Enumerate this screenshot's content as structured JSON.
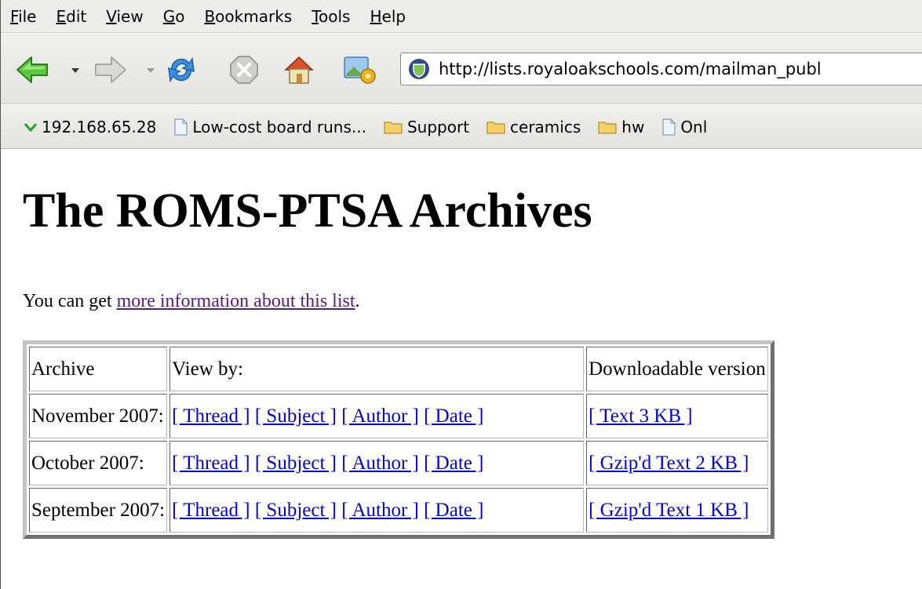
{
  "menu": [
    "File",
    "Edit",
    "View",
    "Go",
    "Bookmarks",
    "Tools",
    "Help"
  ],
  "menu_underline": [
    "F",
    "E",
    "V",
    "G",
    "B",
    "T",
    "H"
  ],
  "toolbar": {
    "back_icon": "back-arrow-icon",
    "forward_icon": "forward-arrow-icon",
    "reload_icon": "reload-icon",
    "stop_icon": "stop-icon",
    "home_icon": "home-icon",
    "url": "http://lists.royaloakschools.com/mailman_publ"
  },
  "bookmarks": [
    {
      "label": "192.168.65.28",
      "icon": "chevron-down-icon"
    },
    {
      "label": "Low-cost board runs...",
      "icon": "page-icon"
    },
    {
      "label": "Support",
      "icon": "folder-icon"
    },
    {
      "label": "ceramics",
      "icon": "folder-icon"
    },
    {
      "label": "hw",
      "icon": "folder-icon"
    },
    {
      "label": "Onl",
      "icon": "page-icon"
    }
  ],
  "page": {
    "title": "The ROMS-PTSA Archives",
    "intro_prefix": "You can get ",
    "intro_link": "more information about this list",
    "intro_suffix": "."
  },
  "table": {
    "headers": [
      "Archive",
      "View by:",
      "Downloadable version"
    ],
    "rows": [
      {
        "archive": "November 2007:",
        "thread": "[ Thread ]",
        "subject": "[ Subject ]",
        "author": "[ Author ]",
        "date": "[ Date ]",
        "download": "[ Text 3 KB ]"
      },
      {
        "archive": "October 2007:",
        "thread": "[ Thread ]",
        "subject": "[ Subject ]",
        "author": "[ Author ]",
        "date": "[ Date ]",
        "download": "[ Gzip'd Text 2 KB ]"
      },
      {
        "archive": "September 2007:",
        "thread": "[ Thread ]",
        "subject": "[ Subject ]",
        "author": "[ Author ]",
        "date": "[ Date ]",
        "download": "[ Gzip'd Text 1 KB ]"
      }
    ]
  },
  "colors": {
    "visited_link": "#551a8b",
    "link": "#0000ee",
    "back_arrow": "#3fb02b",
    "reload": "#2a7fd4",
    "folder": "#f0c75a"
  }
}
